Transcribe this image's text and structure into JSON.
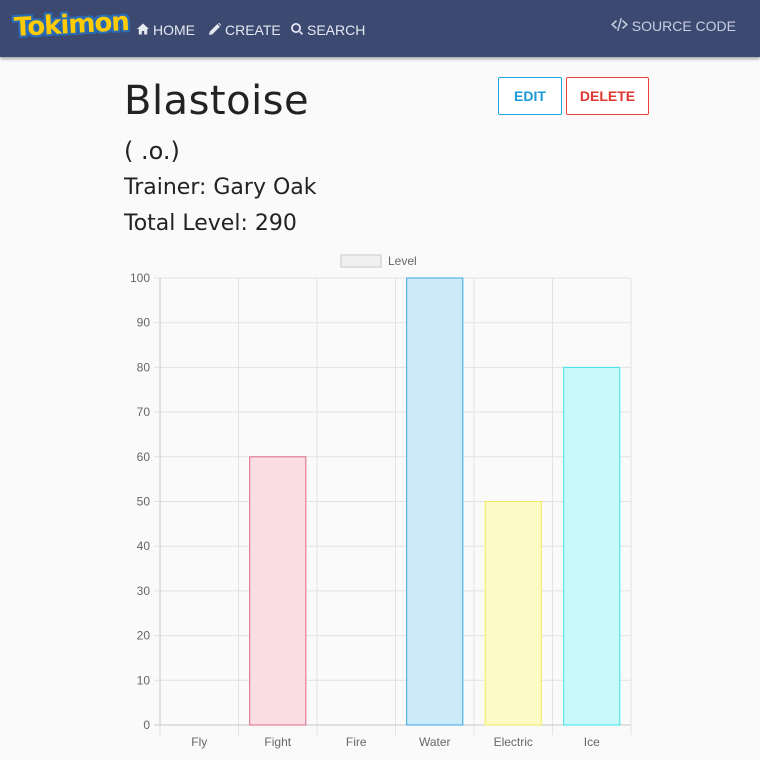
{
  "nav": {
    "logo": "Tokimon",
    "items": [
      {
        "label": "HOME",
        "icon": "home-icon"
      },
      {
        "label": "CREATE",
        "icon": "pencil-icon"
      },
      {
        "label": "SEARCH",
        "icon": "search-icon"
      }
    ],
    "source": {
      "label": "SOURCE CODE",
      "icon": "code-icon"
    }
  },
  "pokemon": {
    "name": "Blastoise",
    "face": "( .o.)",
    "trainer": "Trainer: Gary Oak",
    "total_level": "Total Level: 290"
  },
  "actions": {
    "edit": "EDIT",
    "delete": "DELETE",
    "edit_color": "#1ea5e0",
    "delete_color": "#e8413c"
  },
  "colors": {
    "navbar": "#3c4a71",
    "logo": "#ffcb05"
  },
  "chart_data": {
    "type": "bar",
    "categories": [
      "Fly",
      "Fight",
      "Fire",
      "Water",
      "Electric",
      "Ice"
    ],
    "series": [
      {
        "name": "Level",
        "values": [
          0,
          60,
          0,
          100,
          50,
          80
        ],
        "fill": [
          "rgba(255,255,255,0.3)",
          "#fbdde4",
          "#fde6cc",
          "#cdeafa",
          "#fdfbc5",
          "#c8fafa"
        ],
        "stroke": [
          "#cccccc",
          "#e06a87",
          "#f0a050",
          "#36a8e0",
          "#f2ea5c",
          "#40e0e8"
        ]
      }
    ],
    "ylim": [
      0,
      100
    ],
    "yticks": [
      0,
      10,
      20,
      30,
      40,
      50,
      60,
      70,
      80,
      90,
      100
    ],
    "grid": true,
    "legend": "top-center"
  }
}
